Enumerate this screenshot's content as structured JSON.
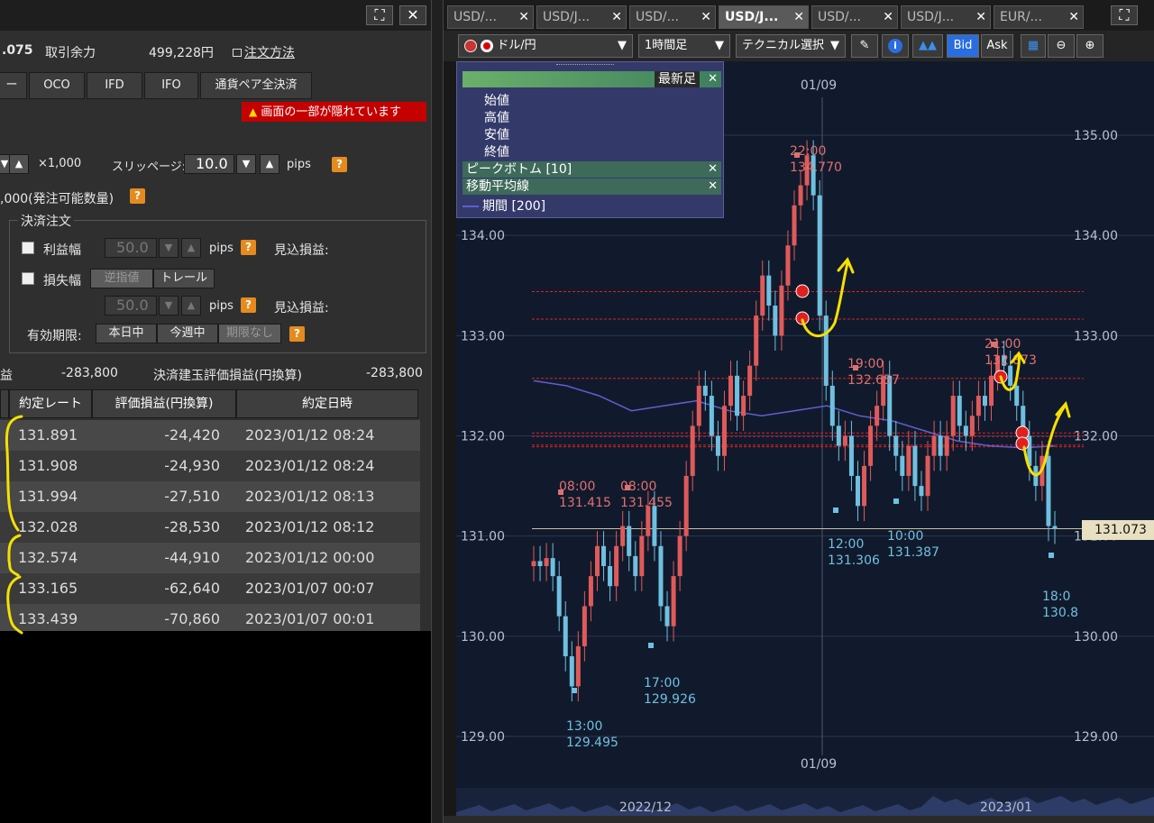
{
  "left": {
    "title_buttons": [
      "⛶",
      "✕"
    ],
    "rate_fragment": ".075",
    "margin_label": "取引余力",
    "margin_value": "499,228円",
    "order_method_link": "注文方法",
    "order_types": [
      "ー",
      "OCO",
      "IFD",
      "IFO",
      "通貨ペア全決済"
    ],
    "warning": "画面の一部が隠れています",
    "lot_unit": "×1,000",
    "slippage_label": "スリッページ:",
    "slippage_value": "10.0",
    "pips": "pips",
    "max_qty": ",000(発注可能数量)",
    "settlement_group": "決済注文",
    "take_profit_label": "利益幅",
    "take_profit_value": "50.0",
    "stop_loss_label": "損失幅",
    "stop_modes": [
      "逆指値",
      "トレール"
    ],
    "stop_loss_value": "50.0",
    "expected_pl_label": "見込損益:",
    "expiry_label": "有効期限:",
    "expiry_options": [
      "本日中",
      "今週中",
      "期限なし"
    ],
    "pl_label": "益",
    "pl_value": "-283,800",
    "eval_pl_label": "決済建玉評価損益(円換算)",
    "eval_pl_value": "-283,800",
    "grid_headers": [
      "約定レート",
      "評価損益(円換算)",
      "約定日時"
    ],
    "positions": [
      {
        "rate": "131.891",
        "pl": "-24,420",
        "time": "2023/01/12 08:24"
      },
      {
        "rate": "131.908",
        "pl": "-24,930",
        "time": "2023/01/12 08:24"
      },
      {
        "rate": "131.994",
        "pl": "-27,510",
        "time": "2023/01/12 08:13"
      },
      {
        "rate": "132.028",
        "pl": "-28,530",
        "time": "2023/01/12 08:12"
      },
      {
        "rate": "132.574",
        "pl": "-44,910",
        "time": "2023/01/12 00:00"
      },
      {
        "rate": "133.165",
        "pl": "-62,640",
        "time": "2023/01/07 00:07"
      },
      {
        "rate": "133.439",
        "pl": "-70,860",
        "time": "2023/01/07 00:01"
      }
    ]
  },
  "right": {
    "tabs": [
      {
        "label": "USD/...",
        "active": false
      },
      {
        "label": "USD/J...",
        "active": false
      },
      {
        "label": "USD/...",
        "active": false
      },
      {
        "label": "USD/J...",
        "active": true
      },
      {
        "label": "USD/...",
        "active": false
      },
      {
        "label": "USD/J...",
        "active": false
      },
      {
        "label": "EUR/...",
        "active": false
      }
    ],
    "pair_select": "ドル/円",
    "timeframe_select": "1時間足",
    "technical_select": "テクニカル選択",
    "bid_label": "Bid",
    "ask_label": "Ask",
    "panel": {
      "latest_bar": "最新足",
      "ohlc": [
        "始値",
        "高値",
        "安値",
        "終値"
      ],
      "peak_bottom": "ピークボトム [10]",
      "ma": "移動平均線",
      "period": "期間 [200]"
    },
    "current_price": "131.073"
  },
  "colors": {
    "bg": "#111a2c",
    "up": "#e05a5a",
    "down": "#6fc0e0",
    "ma": "#5f5fd0",
    "hline_red": "#e02020",
    "annotation": "#f5e000"
  },
  "chart_data": {
    "type": "candlestick",
    "instrument": "USD/JPY",
    "timeframe": "1時間足",
    "ylim": [
      128.7,
      135.6
    ],
    "y_ticks": [
      129.0,
      130.0,
      131.0,
      132.0,
      133.0,
      134.0,
      135.0
    ],
    "y_tick_labels": [
      "129.00",
      "130.00",
      "131.00",
      "132.00",
      "133.00",
      "134.00",
      "135.00"
    ],
    "x_labels": [
      "01/09",
      "01/09",
      "2022/12",
      "2023/01"
    ],
    "closes": [
      130.75,
      130.7,
      130.78,
      130.6,
      130.2,
      129.8,
      129.5,
      129.9,
      130.3,
      130.6,
      130.9,
      130.7,
      130.5,
      130.9,
      131.1,
      130.8,
      130.6,
      131.0,
      131.3,
      130.9,
      130.3,
      130.1,
      130.6,
      131.0,
      131.6,
      132.1,
      132.5,
      132.4,
      132.0,
      131.8,
      132.3,
      132.6,
      132.2,
      132.4,
      132.7,
      133.2,
      133.6,
      133.3,
      133.0,
      133.5,
      133.9,
      134.3,
      134.5,
      134.8,
      134.4,
      133.2,
      132.5,
      132.1,
      131.9,
      132.0,
      131.6,
      131.3,
      131.7,
      132.1,
      132.3,
      132.6,
      132.0,
      131.8,
      131.6,
      131.9,
      131.5,
      131.4,
      131.8,
      132.0,
      131.8,
      132.0,
      132.4,
      132.1,
      132.0,
      132.2,
      132.4,
      132.3,
      132.6,
      132.8,
      132.7,
      132.5,
      132.3,
      132.0,
      131.7,
      131.5,
      131.8,
      131.1,
      131.07
    ],
    "ma_values": [
      132.55,
      132.5,
      132.4,
      132.25,
      132.3,
      132.35,
      132.25,
      132.2,
      132.25,
      132.3,
      132.2,
      132.15,
      132.05,
      131.95,
      131.9,
      131.88,
      131.9
    ],
    "peak_bottom_labels": [
      {
        "time": "08:00",
        "price": "131.415",
        "type": "peak"
      },
      {
        "time": "08:00",
        "price": "131.455",
        "type": "peak"
      },
      {
        "time": "13:00",
        "price": "129.495",
        "type": "bottom"
      },
      {
        "time": "17:00",
        "price": "129.926",
        "type": "bottom"
      },
      {
        "time": "22:00",
        "price": "134.770",
        "type": "peak"
      },
      {
        "time": "19:00",
        "price": "132.657",
        "type": "peak"
      },
      {
        "time": "12:00",
        "price": "131.306",
        "type": "bottom"
      },
      {
        "time": "10:00",
        "price": "131.387",
        "type": "bottom"
      },
      {
        "time": "21:00",
        "price": "132.873",
        "type": "peak"
      },
      {
        "time": "18:0",
        "price": "130.8",
        "type": "bottom"
      }
    ],
    "position_lines": [
      133.439,
      133.165,
      132.574,
      132.028,
      131.994,
      131.908,
      131.891
    ],
    "current_price_line": 131.073
  }
}
